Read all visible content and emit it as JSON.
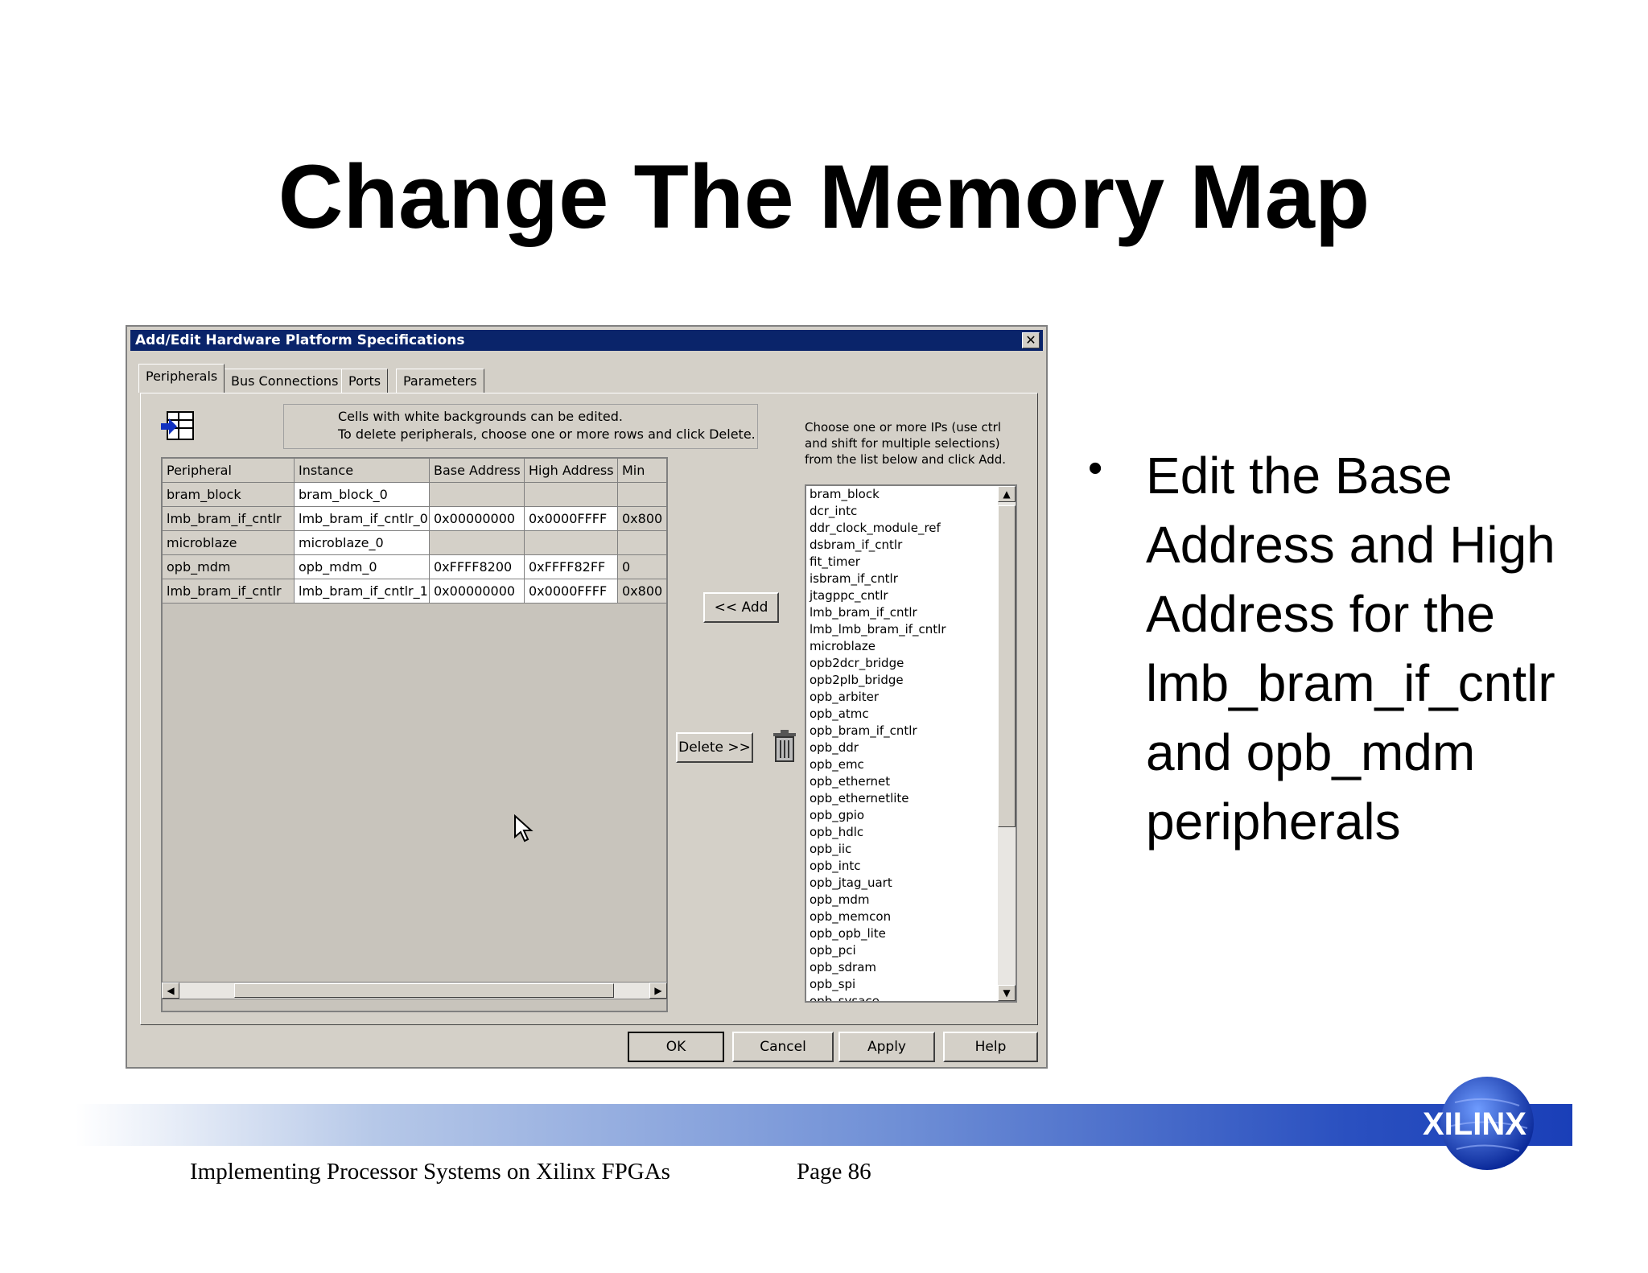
{
  "slide": {
    "title": "Change The Memory Map",
    "bullet_lines": [
      "Edit the Base",
      "Address and High",
      "Address for the",
      "lmb_bram_if_cntlr",
      "and opb_mdm",
      "peripherals"
    ],
    "footer_text": "Implementing Processor Systems on Xilinx FPGAs",
    "page_label": "Page 86",
    "logo_text": "XILINX"
  },
  "dialog": {
    "title": "Add/Edit Hardware Platform Specifications",
    "close_glyph": "✕",
    "tabs": [
      "Peripherals",
      "Bus Connections",
      "Ports",
      "Parameters"
    ],
    "info_lines": [
      "Cells with white backgrounds can be edited.",
      "To delete peripherals, choose one or more rows and click Delete."
    ],
    "table": {
      "headers": [
        "Peripheral",
        "Instance",
        "Base Address",
        "High Address",
        "Min"
      ],
      "rows": [
        [
          "bram_block",
          "bram_block_0",
          "",
          "",
          ""
        ],
        [
          "lmb_bram_if_cntlr",
          "lmb_bram_if_cntlr_0",
          "0x00000000",
          "0x0000FFFF",
          "0x800"
        ],
        [
          "microblaze",
          "microblaze_0",
          "",
          "",
          ""
        ],
        [
          "opb_mdm",
          "opb_mdm_0",
          "0xFFFF8200",
          "0xFFFF82FF",
          "0"
        ],
        [
          "lmb_bram_if_cntlr",
          "lmb_bram_if_cntlr_1",
          "0x00000000",
          "0x0000FFFF",
          "0x800"
        ]
      ]
    },
    "add_button": "<< Add",
    "delete_button": "Delete >>",
    "choose_lines": [
      "Choose one or more IPs (use ctrl",
      "and shift for multiple selections)",
      "from the list below and click Add."
    ],
    "ip_list": [
      "bram_block",
      "dcr_intc",
      "ddr_clock_module_ref",
      "dsbram_if_cntlr",
      "fit_timer",
      "isbram_if_cntlr",
      "jtagppc_cntlr",
      "lmb_bram_if_cntlr",
      "lmb_lmb_bram_if_cntlr",
      "microblaze",
      "opb2dcr_bridge",
      "opb2plb_bridge",
      "opb_arbiter",
      "opb_atmc",
      "opb_bram_if_cntlr",
      "opb_ddr",
      "opb_emc",
      "opb_ethernet",
      "opb_ethernetlite",
      "opb_gpio",
      "opb_hdlc",
      "opb_iic",
      "opb_intc",
      "opb_jtag_uart",
      "opb_mdm",
      "opb_memcon",
      "opb_opb_lite",
      "opb_pci",
      "opb_sdram",
      "opb_spi",
      "opb_sysace"
    ],
    "footer_buttons": {
      "ok": "OK",
      "cancel": "Cancel",
      "apply": "Apply",
      "help": "Help"
    }
  }
}
